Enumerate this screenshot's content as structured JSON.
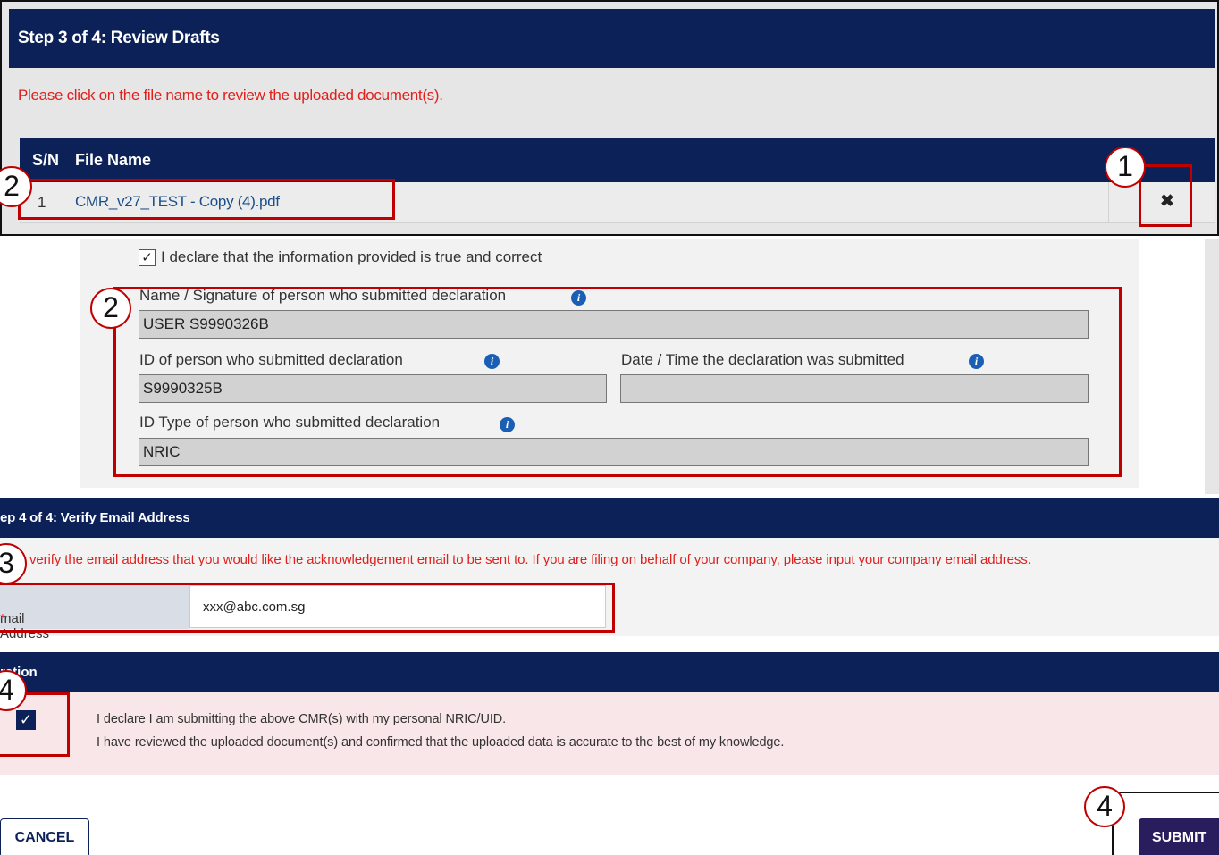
{
  "step3": {
    "title": "Step 3 of 4: Review Drafts",
    "instruction": "Please click on the file name to review the uploaded document(s).",
    "columns": [
      "S/N",
      "File Name"
    ],
    "rows": [
      {
        "sn": "1",
        "file_name": "CMR_v27_TEST - Copy (4).pdf",
        "delete_icon": "✖"
      }
    ]
  },
  "declaration_form": {
    "confirm_checkbox_mark": "✓",
    "confirm_label": "I declare that the information provided is true and correct",
    "name_label": "Name / Signature of person who submitted declaration",
    "name_value": "USER S9990326B",
    "id_label": "ID of person who submitted declaration",
    "id_value": "S9990325B",
    "datetime_label": "Date / Time the declaration was submitted",
    "datetime_value": "",
    "id_type_label": "ID Type of person who submitted declaration",
    "id_type_value": "NRIC",
    "info_icon_glyph": "i"
  },
  "step4": {
    "title": "ep 4 of 4: Verify Email Address",
    "instruction": "verify the email address that you would like the acknowledgement email to be sent to. If you are filing on behalf of your company, please input your company email address.",
    "email_label": "mail Address",
    "required_mark": "*",
    "email_value": "xxx@abc.com.sg"
  },
  "declaration": {
    "title": "ration",
    "checkbox_mark": "✓",
    "line1": "I declare I am submitting the above CMR(s) with my personal NRIC/UID.",
    "line2": "I have reviewed the uploaded document(s) and confirmed that the uploaded data is accurate to the best of my knowledge."
  },
  "buttons": {
    "cancel_label": "CANCEL",
    "submit_label": "SUBMIT"
  },
  "annotations": {
    "callout_1": "1",
    "callout_2a": "2",
    "callout_2b": "2",
    "callout_3": "3",
    "callout_4a": "4",
    "callout_4b": "4",
    "highlight_color": "#c00000"
  },
  "colors": {
    "navy": "#0b2157",
    "alert_red": "#e0201c",
    "link_blue": "#1a4e8a",
    "submit_purple": "#2a1d5e",
    "declaration_pink": "#f9e6e8"
  }
}
